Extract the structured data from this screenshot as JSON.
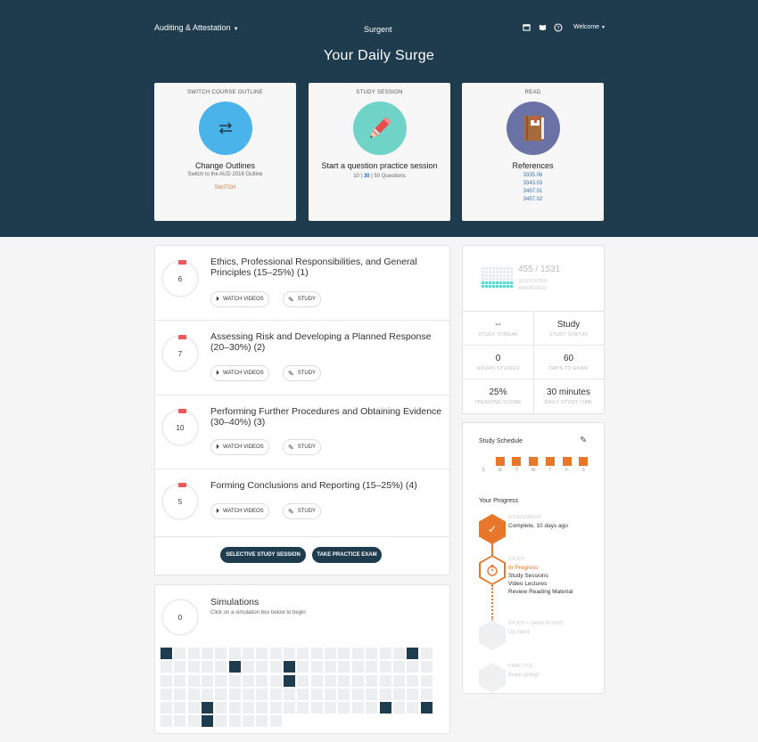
{
  "header": {
    "course": "Auditing & Attestation",
    "brand": "Surgent",
    "welcome": "Welcome",
    "title": "Your Daily Surge",
    "icons": [
      "calendar-icon",
      "book-icon",
      "help-icon"
    ]
  },
  "cards": {
    "switch": {
      "label": "SWITCH COURSE OUTLINE",
      "title": "Change Outlines",
      "sub": "Switch to the AUD 2016 Outline",
      "link": "SWITCH",
      "color": "#4ab3ea"
    },
    "study": {
      "label": "STUDY SESSION",
      "title": "Start a question practice session",
      "q1": "10",
      "sep1": "|",
      "q2": "30",
      "sep2": "|",
      "q3": "50 Questions",
      "color": "#6fd3c8"
    },
    "read": {
      "label": "READ",
      "title": "References",
      "refs": [
        "3335.06",
        "3343.03",
        "3457.01",
        "3457.02"
      ],
      "color": "#6a72a6"
    }
  },
  "topics": [
    {
      "count": "6",
      "title": "Ethics, Professional Responsibilities, and General Principles (15–25%) (1)",
      "watch": "WATCH VIDEOS",
      "study": "STUDY"
    },
    {
      "count": "7",
      "title": "Assessing Risk and Developing a Planned Response (20–30%) (2)",
      "watch": "WATCH VIDEOS",
      "study": "STUDY"
    },
    {
      "count": "10",
      "title": "Performing Further Procedures and Obtaining Evidence (30–40%) (3)",
      "watch": "WATCH VIDEOS",
      "study": "STUDY"
    },
    {
      "count": "5",
      "title": "Forming Conclusions and Reporting (15–25%) (4)",
      "watch": "WATCH VIDEOS",
      "study": "STUDY"
    }
  ],
  "actions": {
    "selective": "SELECTIVE STUDY SESSION",
    "exam": "TAKE PRACTICE EXAM"
  },
  "simulations": {
    "count": "0",
    "title": "Simulations",
    "sub": "Click on a simulation box below to begin",
    "rows": [
      [
        1,
        0,
        0,
        0,
        0,
        0,
        0,
        0,
        0,
        0,
        0,
        0,
        0,
        0,
        0,
        0,
        0,
        0,
        1,
        0
      ],
      [
        0,
        0,
        0,
        0,
        0,
        1,
        0,
        0,
        0,
        1,
        0,
        0,
        0,
        0,
        0,
        0,
        0,
        0,
        0,
        0
      ],
      [
        0,
        0,
        0,
        0,
        0,
        0,
        0,
        0,
        0,
        1,
        0,
        0,
        0,
        0,
        0,
        0,
        0,
        0,
        0,
        0
      ],
      [
        0,
        0,
        0,
        0,
        0,
        0,
        0,
        0,
        0,
        0,
        0,
        0,
        0,
        0,
        0,
        0,
        0,
        0,
        0,
        0
      ],
      [
        0,
        0,
        0,
        1,
        0,
        0,
        0,
        0,
        0,
        0,
        0,
        0,
        0,
        0,
        0,
        0,
        1,
        0,
        0,
        1
      ],
      [
        0,
        0,
        0,
        1,
        0,
        0,
        0,
        0,
        0,
        -1,
        -1,
        -1,
        -1,
        -1,
        -1,
        -1,
        -1,
        -1,
        -1,
        -1
      ]
    ]
  },
  "stats": {
    "answered": "455",
    "sep": "/",
    "total": "1531",
    "answered_label": "QUESTIONS ANSWERED",
    "answered_fraction": 0.297,
    "cells": [
      {
        "v": "--",
        "k": "STUDY STREAK"
      },
      {
        "v": "Study",
        "k": "STUDY STATUS"
      },
      {
        "v": "0",
        "k": "HOURS STUDIED"
      },
      {
        "v": "60",
        "k": "DAYS TO EXAM"
      },
      {
        "v": "25%",
        "k": "TRENDING SCORE"
      },
      {
        "v": "30 minutes",
        "k": "DAILY STUDY TIME"
      }
    ]
  },
  "schedule": {
    "title": "Study Schedule",
    "days": [
      {
        "l": "S",
        "on": false
      },
      {
        "l": "M",
        "on": true
      },
      {
        "l": "T",
        "on": true
      },
      {
        "l": "W",
        "on": true
      },
      {
        "l": "T",
        "on": true
      },
      {
        "l": "F",
        "on": true
      },
      {
        "l": "S",
        "on": true
      }
    ]
  },
  "progress": {
    "title": "Your Progress",
    "steps": [
      {
        "k": "ASSESSMENT",
        "v": "Complete, 10 days ago"
      },
      {
        "k": "STUDY",
        "v": "In Progress",
        "items": [
          "Study Sessions",
          "Video Lectures",
          "Review Reading Material"
        ]
      },
      {
        "k": "STUDY + SIMULATIONS",
        "v": "Up Next"
      },
      {
        "k": "PRACTICE",
        "v": "Keep going!"
      }
    ],
    "accent": "#e8762b"
  }
}
